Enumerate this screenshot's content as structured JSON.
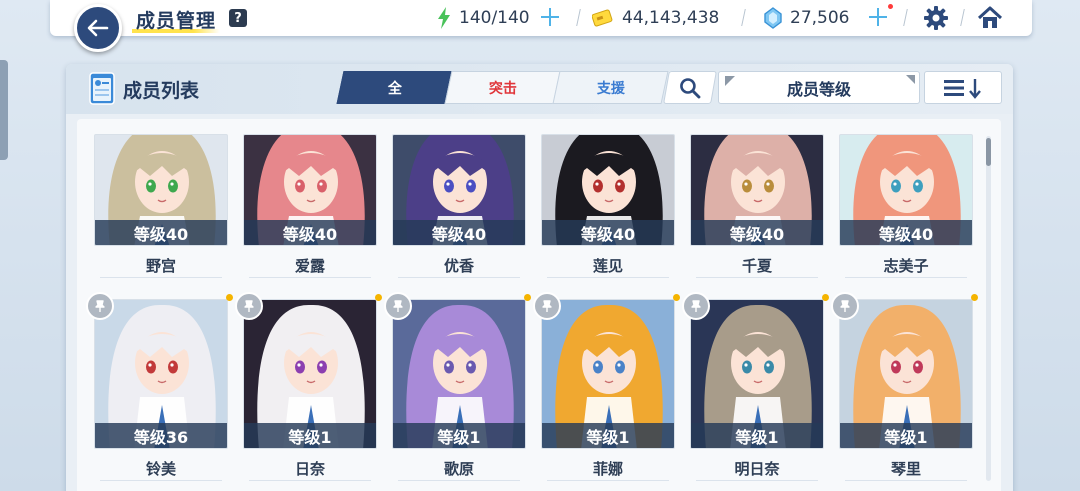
{
  "header": {
    "title": "成员管理",
    "help": "?",
    "ap": "140/140",
    "credits": "44,143,438",
    "gems": "27,506"
  },
  "panel": {
    "title": "成员列表",
    "tabs": [
      {
        "label": "全"
      },
      {
        "label": "突击"
      },
      {
        "label": "支援"
      }
    ],
    "sort_value": "成员等级"
  },
  "members_row1": [
    {
      "name": "野宫",
      "level": "等级40",
      "bg": "#dfe6ee",
      "hair": "#cbbf9e",
      "eye": "#3ea84e"
    },
    {
      "name": "爱露",
      "level": "等级40",
      "bg": "#3b3142",
      "hair": "#e6878c",
      "eye": "#d9606a"
    },
    {
      "name": "优香",
      "level": "等级40",
      "bg": "#3e4c6a",
      "hair": "#4c3f88",
      "eye": "#4b4fc2"
    },
    {
      "name": "莲见",
      "level": "等级40",
      "bg": "#c8ccd4",
      "hair": "#1b1a20",
      "eye": "#b3302e"
    },
    {
      "name": "千夏",
      "level": "等级40",
      "bg": "#2c2d42",
      "hair": "#ddb0a8",
      "eye": "#b98d3c"
    },
    {
      "name": "志美子",
      "level": "等级40",
      "bg": "#d7ecef",
      "hair": "#f0967c",
      "eye": "#3e9fbe"
    }
  ],
  "members_row2": [
    {
      "name": "铃美",
      "level": "等级36",
      "bg": "#c9d9e8",
      "hair": "#eeeef3",
      "eye": "#c23a3a"
    },
    {
      "name": "日奈",
      "level": "等级1",
      "bg": "#2a2434",
      "hair": "#f1eff2",
      "eye": "#8c3fb0"
    },
    {
      "name": "歌原",
      "level": "等级1",
      "bg": "#5a6a9a",
      "hair": "#a88ad8",
      "eye": "#6a5ab0"
    },
    {
      "name": "菲娜",
      "level": "等级1",
      "bg": "#8ab0d8",
      "hair": "#f0a830",
      "eye": "#4a82c8"
    },
    {
      "name": "明日奈",
      "level": "等级1",
      "bg": "#2a3656",
      "hair": "#a89c8a",
      "eye": "#3a8aa8"
    },
    {
      "name": "琴里",
      "level": "等级1",
      "bg": "#c5d3e0",
      "hair": "#f2b06a",
      "eye": "#c03a5a"
    }
  ],
  "colors": {
    "navy": "#2d4a7c",
    "striker_red": "#e0353a",
    "special_blue": "#3a7bd1",
    "level_bar": "#263a58",
    "new_dot": "#f5b400"
  },
  "icons": [
    "back-arrow-icon",
    "help-icon",
    "ap-bolt-icon",
    "credit-card-icon",
    "gem-icon",
    "plus-icon",
    "gear-icon",
    "home-icon",
    "student-list-icon",
    "search-icon",
    "sort-order-icon",
    "pin-icon"
  ]
}
